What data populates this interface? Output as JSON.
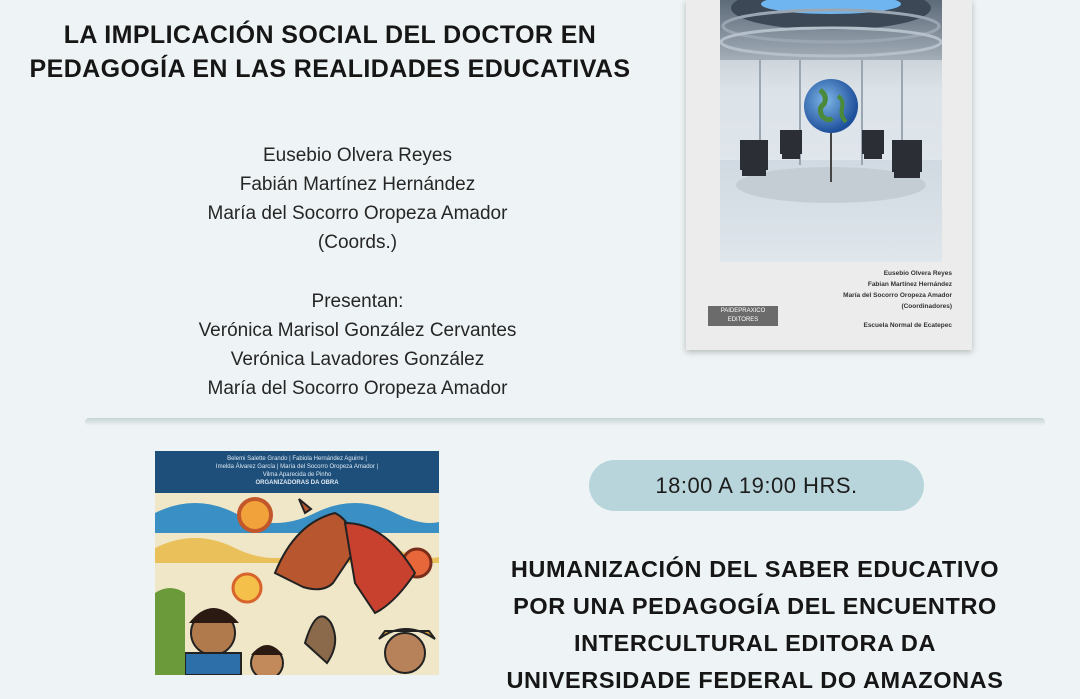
{
  "event1": {
    "title_line1": "LA IMPLICACIÓN SOCIAL DEL DOCTOR EN",
    "title_line2": "PEDAGOGÍA EN LAS REALIDADES EDUCATIVAS",
    "coordinators": [
      "Eusebio Olvera Reyes",
      "Fabián Martínez Hernández",
      "María del Socorro Oropeza Amador",
      "(Coords.)"
    ],
    "presenters_label": "Presentan:",
    "presenters": [
      "Verónica Marisol González Cervantes",
      "Verónica Lavadores González",
      "María del Socorro Oropeza Amador"
    ],
    "cover": {
      "authors": [
        "Eusebio Olvera Reyes",
        "Fabian Martínez Hernández",
        "María del Socorro Oropeza Amador",
        "(Coordinadores)"
      ],
      "school": "Escuela Normal de Ecatepec",
      "publisher": "PAIDEPRAXICO EDITORES"
    }
  },
  "event2": {
    "time": "18:00 A 19:00 HRS.",
    "title_lines": [
      "HUMANIZACIÓN DEL SABER EDUCATIVO",
      "POR UNA PEDAGOGÍA DEL ENCUENTRO",
      "INTERCULTURAL EDITORA DA",
      "UNIVERSIDADE FEDERAL DO AMAZONAS"
    ],
    "cover": {
      "authors_line1": "Belemi Salette Grando | Fabiola Hernández Aguirre |",
      "authors_line2": "Imelda Álvarez García | María del Socorro Oropeza Amador |",
      "authors_line3": "Vilma Aparecida de Pinho",
      "editors_label": "ORGANIZADORAS DA OBRA"
    }
  },
  "colors": {
    "background": "#eef4f5",
    "time_pill": "#b9d5dc",
    "cover2_blue": "#1d4f7a"
  }
}
